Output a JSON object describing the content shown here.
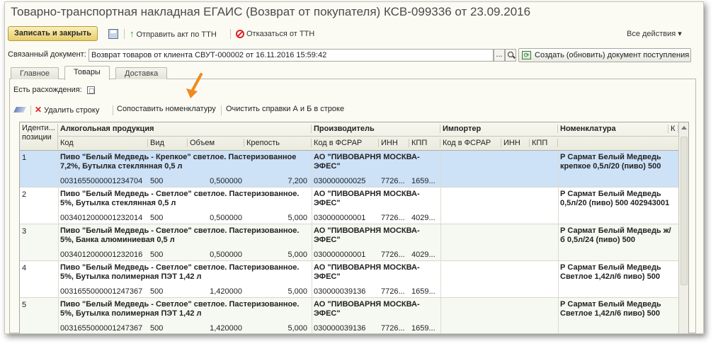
{
  "window": {
    "title": "Товарно-транспортная накладная ЕГАИС (Возврат от покупателя) КСВ-099336 от 23.09.2016"
  },
  "toolbar": {
    "save_close_label": "Записать и закрыть",
    "send_act_label": "Отправить акт по ТТН",
    "refuse_label": "Отказаться от ТТН",
    "all_actions_label": "Все действия ▾"
  },
  "linked_doc": {
    "label": "Связанный документ:",
    "value": "Возврат товаров от клиента СВУТ-000002 от 16.11.2016 15:59:42",
    "select_label": "...",
    "create_label": "Создать (обновить) документ поступления"
  },
  "tabs": [
    {
      "label": "Главное"
    },
    {
      "label": "Товары"
    },
    {
      "label": "Доставка"
    }
  ],
  "discrepancies_label": "Есть расхождения:",
  "subtoolbar": {
    "delete_label": "Удалить строку",
    "match_label": "Сопоставить номенклатуру",
    "clear_label": "Очистить справки А и Б в строке"
  },
  "grid": {
    "headers": {
      "id_line1": "Иденти...",
      "id_line2": "позиции",
      "alcohol": "Алкогольная продукция",
      "code": "Код",
      "vid": "Вид",
      "volume": "Объем",
      "strength": "Крепость",
      "producer": "Производитель",
      "producer_code": "Код в ФСРАР",
      "producer_inn": "ИНН",
      "producer_kpp": "КПП",
      "importer": "Импортер",
      "importer_code": "Код в ФСРАР",
      "importer_inn": "ИНН",
      "importer_kpp": "КПП",
      "nomenclature": "Номенклатура",
      "extra": "К"
    },
    "rows": [
      {
        "num": "1",
        "name": "Пиво \"Белый Медведь - Крепкое\" светлое. Пастеризованное 7,2%, Бутылка стеклянная 0,5 л",
        "code": "0031655000001234704",
        "vid": "500",
        "volume": "0,500000",
        "strength": "7,200",
        "producer": "АО \"ПИВОВАРНЯ МОСКВА-ЭФЕС\"",
        "producer_code": "030000000025",
        "inn": "7726...",
        "kpp": "1659...",
        "nomenclature": "Р Сармат Белый Медведь крепкое 0,5л/20 (пиво) 500"
      },
      {
        "num": "2",
        "name": "Пиво \"Белый Медведь - Светлое\" светлое. Пастеризованное. 5%, Бутылка стеклянная 0,5 л",
        "code": "0034012000001232014",
        "vid": "500",
        "volume": "0,500000",
        "strength": "5,000",
        "producer": "АО \"ПИВОВАРНЯ МОСКВА-ЭФЕС\"",
        "producer_code": "030000000001",
        "inn": "7726...",
        "kpp": "4029...",
        "nomenclature": "Р Сармат Белый Медведь 0,5л/20 (пиво) 500 402943001"
      },
      {
        "num": "3",
        "name": "Пиво \"Белый Медведь - Светлое\" светлое. Пастеризованное. 5%, Банка алюминиевая 0,5 л",
        "code": "0034012000001232016",
        "vid": "500",
        "volume": "0,500000",
        "strength": "5,000",
        "producer": "АО \"ПИВОВАРНЯ МОСКВА-ЭФЕС\"",
        "producer_code": "030000000001",
        "inn": "7726...",
        "kpp": "4029...",
        "nomenclature": "Р Сармат Белый Медведь ж/б 0,5л/24 (пиво) 500"
      },
      {
        "num": "4",
        "name": "Пиво \"Белый Медведь - Светлое\" светлое. Пастеризованное. 5%, Бутылка полимерная ПЭТ 1,42 л",
        "code": "0031655000001247367",
        "vid": "500",
        "volume": "1,420000",
        "strength": "5,000",
        "producer": "АО \"ПИВОВАРНЯ МОСКВА-ЭФЕС\"",
        "producer_code": "030000039136",
        "inn": "7726...",
        "kpp": "1659...",
        "nomenclature": "Р Сармат Белый Медведь Светлое 1,42л/6 пиво) 500"
      },
      {
        "num": "5",
        "name": "Пиво \"Белый Медведь - Светлое\" светлое. Пастеризованное. 5%, Бутылка полимерная ПЭТ 1,42 л",
        "code": "0031655000001247367",
        "vid": "500",
        "volume": "1,420000",
        "strength": "5,000",
        "producer": "АО \"ПИВОВАРНЯ МОСКВА-ЭФЕС\"",
        "producer_code": "030000039136",
        "inn": "7726...",
        "kpp": "1659...",
        "nomenclature": "Р Сармат Белый Медведь Светлое 1,42л/6 пиво) 500"
      }
    ]
  },
  "colors": {
    "selected_row": "#cde1f7",
    "accent_arrow": "#f08a1c",
    "primary_button": "#e7cd6c"
  }
}
